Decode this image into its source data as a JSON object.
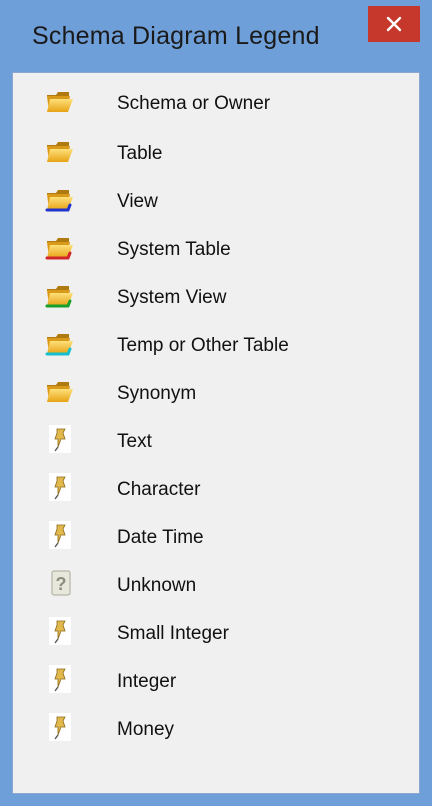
{
  "window": {
    "title": "Schema Diagram Legend",
    "close_glyph": "✕"
  },
  "legend": {
    "items": [
      {
        "label": "Schema or Owner",
        "icon": "folder-icon",
        "accent": "#e8a317"
      },
      {
        "label": "Table",
        "icon": "folder-icon",
        "accent": "#e8a317"
      },
      {
        "label": "View",
        "icon": "folder-view-icon",
        "accent": "#2233cc"
      },
      {
        "label": "System Table",
        "icon": "folder-system-table-icon",
        "accent": "#d0262a"
      },
      {
        "label": "System View",
        "icon": "folder-system-view-icon",
        "accent": "#1aa02a"
      },
      {
        "label": "Temp or Other Table",
        "icon": "folder-temp-icon",
        "accent": "#14c0d0"
      },
      {
        "label": "Synonym",
        "icon": "folder-icon",
        "accent": "#e8a317"
      },
      {
        "label": "Text",
        "icon": "pushpin-icon"
      },
      {
        "label": "Character",
        "icon": "pushpin-icon"
      },
      {
        "label": "Date Time",
        "icon": "pushpin-icon"
      },
      {
        "label": "Unknown",
        "icon": "question-mark-icon"
      },
      {
        "label": "Small Integer",
        "icon": "pushpin-icon"
      },
      {
        "label": "Integer",
        "icon": "pushpin-icon"
      },
      {
        "label": "Money",
        "icon": "pushpin-icon"
      }
    ]
  }
}
